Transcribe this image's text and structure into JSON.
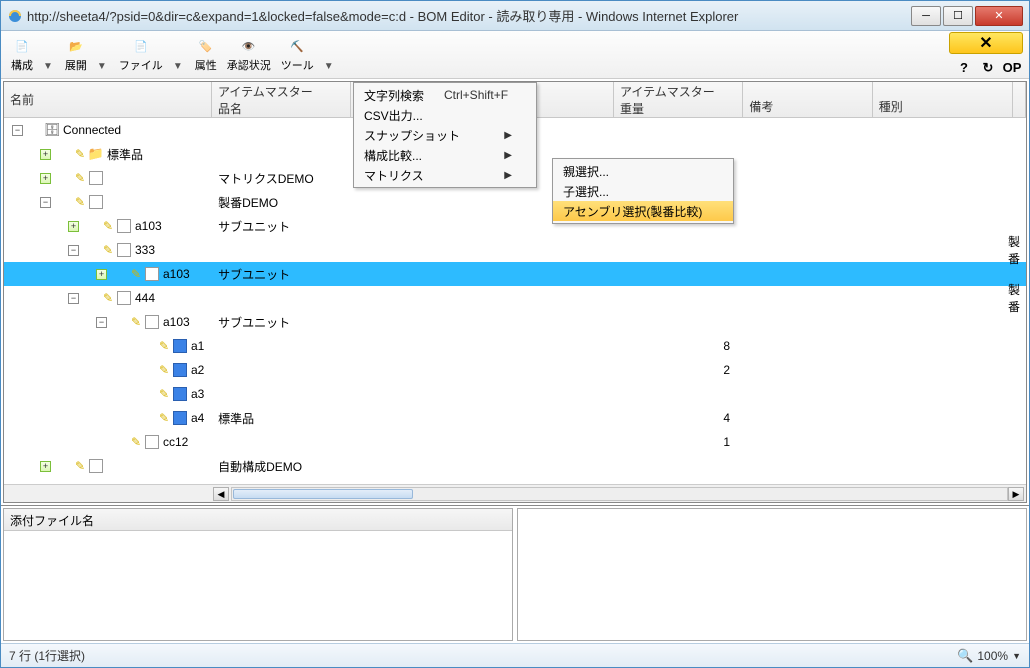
{
  "window": {
    "title": "http://sheeta4/?psid=0&dir=c&expand=1&locked=false&mode=c:d - BOM Editor - 読み取り専用 - Windows Internet Explorer"
  },
  "toolbar": {
    "items": [
      "構成",
      "展開",
      "ファイル",
      "属性",
      "承認状況",
      "ツール"
    ],
    "help": {
      "q": "?",
      "r": "↻",
      "op": "OP"
    }
  },
  "columns": {
    "name": "名前",
    "master_label": "アイテムマスター",
    "sub1": "品名",
    "master2": "アイテムマスター",
    "weight": "重量",
    "note": "備考",
    "type": "種別"
  },
  "menu_tools": {
    "items": [
      {
        "label": "文字列検索",
        "shortcut": "Ctrl+Shift+F"
      },
      {
        "label": "CSV出力..."
      },
      {
        "label": "スナップショット",
        "sub": true
      },
      {
        "label": "構成比較...",
        "sub": true
      },
      {
        "label": "マトリクス",
        "sub": true
      }
    ]
  },
  "submenu": {
    "items": [
      {
        "label": "親選択..."
      },
      {
        "label": "子選択..."
      },
      {
        "label": "アセンブリ選択(製番比較)",
        "hl": true
      }
    ]
  },
  "tree": [
    {
      "indent": 0,
      "exp": "minus",
      "icon": "db",
      "label": "Connected"
    },
    {
      "indent": 1,
      "exp": "plus",
      "pencil": true,
      "icon": "folder",
      "label": "標準品",
      "c1": ""
    },
    {
      "indent": 1,
      "exp": "plus",
      "pencil": true,
      "icon": "doc",
      "label": "",
      "c1": "マトリクスDEMO"
    },
    {
      "indent": 1,
      "exp": "minus",
      "pencil": true,
      "icon": "doc",
      "label": "",
      "c1": "製番DEMO"
    },
    {
      "indent": 2,
      "exp": "plus",
      "pencil": true,
      "icon": "doc",
      "label": "a103",
      "c1": "サブユニット"
    },
    {
      "indent": 2,
      "exp": "minus",
      "pencil": true,
      "icon": "doc",
      "label": "333",
      "c1": "",
      "c6": "製番"
    },
    {
      "indent": 3,
      "exp": "plus",
      "pencil": true,
      "icon": "doc",
      "label": "a103",
      "c1": "サブユニット",
      "sel": true
    },
    {
      "indent": 2,
      "exp": "minus",
      "pencil": true,
      "icon": "doc",
      "label": "444",
      "c1": "",
      "c6": "製番"
    },
    {
      "indent": 3,
      "exp": "minus",
      "pencil": true,
      "icon": "doc",
      "label": "a103",
      "c1": "サブユニット"
    },
    {
      "indent": 4,
      "exp": "",
      "pencil": true,
      "icon": "blue",
      "label": "a1",
      "c3": "8"
    },
    {
      "indent": 4,
      "exp": "",
      "pencil": true,
      "icon": "blue",
      "label": "a2",
      "c3": "2"
    },
    {
      "indent": 4,
      "exp": "",
      "pencil": true,
      "icon": "blue",
      "label": "a3",
      "c3": ""
    },
    {
      "indent": 4,
      "exp": "",
      "pencil": true,
      "icon": "blue",
      "label": "a4",
      "c1": "標準品",
      "c3": "4"
    },
    {
      "indent": 3,
      "exp": "",
      "pencil": true,
      "icon": "doc",
      "label": "cc12",
      "c3": "1"
    },
    {
      "indent": 1,
      "exp": "plus",
      "pencil": true,
      "icon": "doc",
      "label": "",
      "c1": "自動構成DEMO"
    }
  ],
  "bottom": {
    "header": "添付ファイル名"
  },
  "status": {
    "text": "7 行 (1行選択)",
    "zoom": "100%"
  }
}
